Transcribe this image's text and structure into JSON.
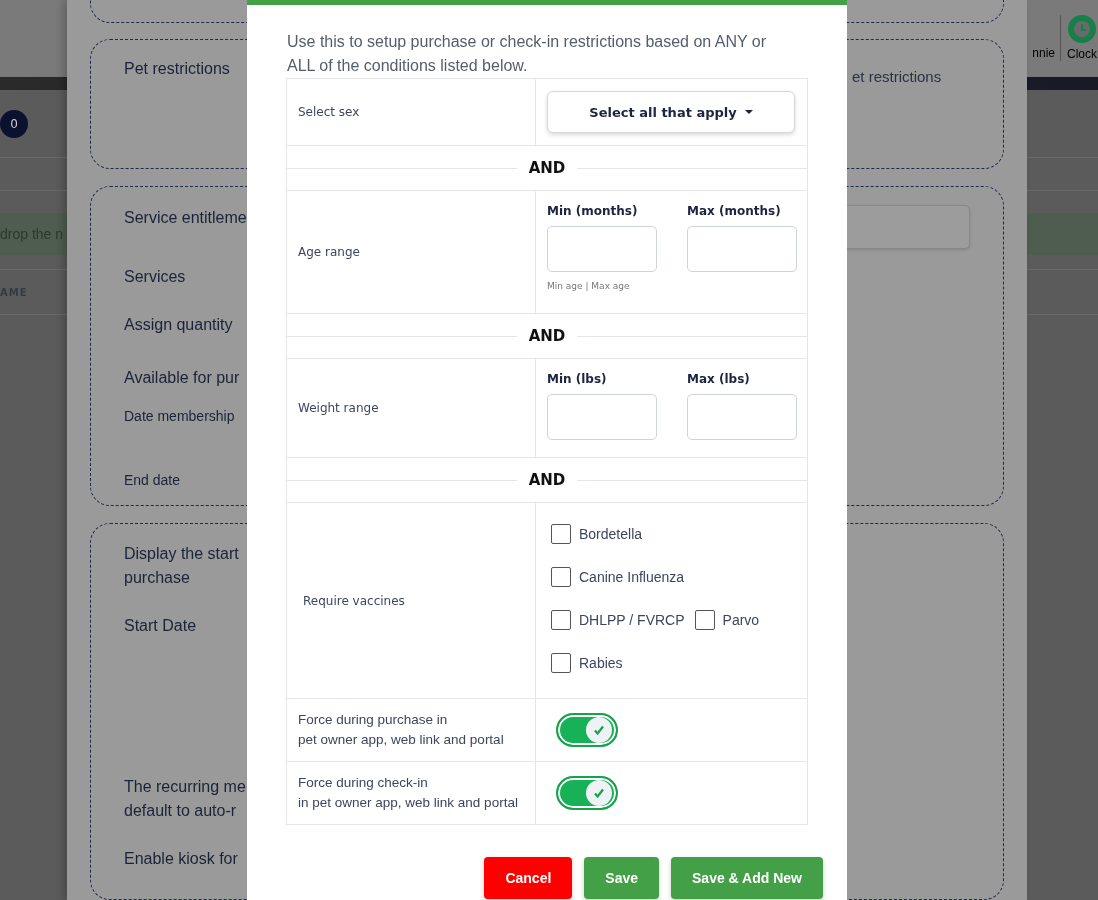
{
  "background_page": {
    "user_name": "nnie",
    "clock_button": "Clock",
    "counter_badge": "0",
    "banner_text": "drop the n",
    "column_header": "AME"
  },
  "drawer": {
    "cards": [
      {
        "labels": [
          {
            "text": "Pet restrictions",
            "kind": "heading"
          }
        ],
        "right_text": "et restrictions",
        "has_field": false
      },
      {
        "labels": [
          {
            "text": "Service entitleme",
            "kind": "heading"
          },
          {
            "text": "Services",
            "kind": "heading"
          },
          {
            "text": "Assign quantity",
            "kind": "heading"
          },
          {
            "text": "Available for pur",
            "kind": "heading"
          },
          {
            "text": "Date membership",
            "kind": "small"
          },
          {
            "text": "End date",
            "kind": "small"
          }
        ],
        "has_field": true
      },
      {
        "labels": [
          {
            "text": "Display the start\npurchase",
            "kind": "heading"
          },
          {
            "text": "Start Date",
            "kind": "heading"
          },
          {
            "text": "The recurring me\ndefault to auto-r",
            "kind": "heading"
          },
          {
            "text": "Enable kiosk for",
            "kind": "heading"
          }
        ],
        "has_field": false
      }
    ]
  },
  "modal": {
    "intro": "Use this to setup purchase or check-in restrictions based on ANY or ALL of the conditions listed below.",
    "sex": {
      "label": "Select sex",
      "dropdown": "Select all that apply"
    },
    "separators": [
      "AND",
      "AND",
      "AND"
    ],
    "age": {
      "label": "Age range",
      "min_label": "Min (months)",
      "max_label": "Max (months)",
      "hint": "Min age | Max age"
    },
    "weight": {
      "label": "Weight range",
      "min_label": "Min (lbs)",
      "max_label": "Max (lbs)"
    },
    "vaccines": {
      "label": "Require vaccines",
      "rows": [
        {
          "options": [
            {
              "label": "Bordetella",
              "checked": false
            }
          ]
        },
        {
          "options": [
            {
              "label": "Canine Influenza",
              "checked": false
            }
          ]
        },
        {
          "options": [
            {
              "label": "DHLPP / FVRCP",
              "checked": false
            },
            {
              "label": "Parvo",
              "checked": false
            }
          ]
        },
        {
          "options": [
            {
              "label": "Rabies",
              "checked": false
            }
          ]
        }
      ]
    },
    "toggles": [
      {
        "label": "Force during purchase in\npet owner app, web link and portal",
        "on": true
      },
      {
        "label": "Force during check-in\nin pet owner app, web link and portal",
        "on": true
      }
    ],
    "buttons": [
      {
        "label": "Cancel",
        "kind": "danger"
      },
      {
        "label": "Save",
        "kind": "primary"
      },
      {
        "label": "Save & Add New",
        "kind": "primary"
      }
    ]
  }
}
